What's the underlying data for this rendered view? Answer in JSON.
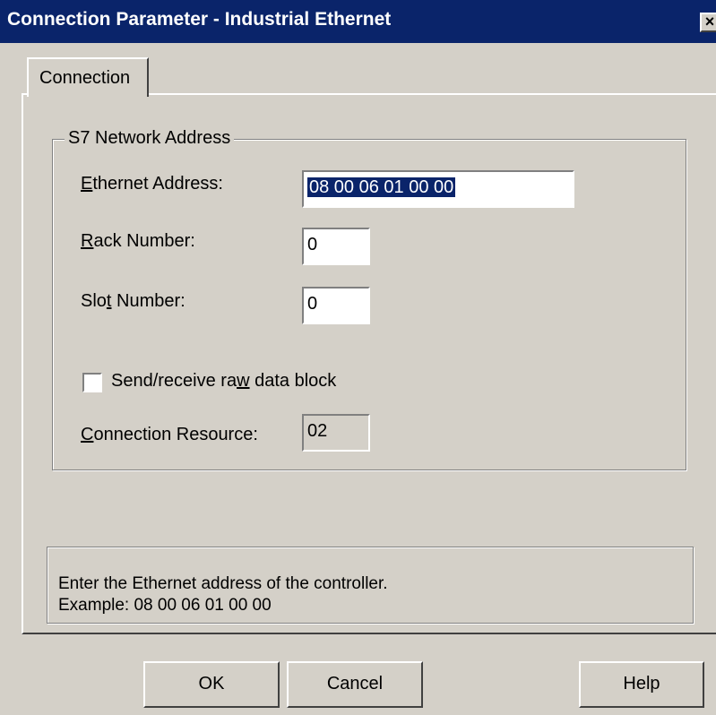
{
  "window": {
    "title": "Connection Parameter - Industrial Ethernet",
    "close_symbol": "×"
  },
  "tabs": [
    {
      "label": "Connection"
    }
  ],
  "group": {
    "title": "S7 Network Address",
    "ethernet_label_key": "E",
    "ethernet_label_rest": "thernet Address:",
    "ethernet_value": "08 00 06 01 00 00",
    "rack_label_key": "R",
    "rack_label_rest": "ack Number:",
    "rack_value": "0",
    "slot_label_pre": "Slo",
    "slot_label_key": "t",
    "slot_label_rest": " Number:",
    "slot_value": "0",
    "raw_checkbox_pre": "Send/receive ra",
    "raw_checkbox_key": "w",
    "raw_checkbox_rest": " data block",
    "raw_checked": false,
    "resource_label_key": "C",
    "resource_label_rest": "onnection Resource:",
    "resource_value": "02"
  },
  "info": {
    "line1": "Enter the Ethernet address of the controller.",
    "line2": "Example: 08 00 06 01 00 00"
  },
  "buttons": {
    "ok": "OK",
    "cancel": "Cancel",
    "help": "Help"
  },
  "colors": {
    "titlebar": "#0a246a",
    "face": "#d4d0c8",
    "selection": "#0a246a"
  }
}
